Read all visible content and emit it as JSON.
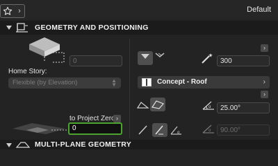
{
  "toolbar": {
    "favorites_icon": "star-outline-icon",
    "more_glyph": "›",
    "preset_label": "Default"
  },
  "section_geometry": {
    "title": "GEOMETRY AND POSITIONING",
    "icon": "geometry-section-icon"
  },
  "geometry": {
    "top_offset_value": "0",
    "home_story_label": "Home Story:",
    "home_story_value": "Flexible (by Elevation)",
    "reference_label": "to Project Zero",
    "bottom_offset_value": "0",
    "thickness_value": "300",
    "surface_override_label": "Concept - Roof",
    "pitch_value": "25.00°",
    "edge_angle_value": "90.00°"
  },
  "section_multiplane": {
    "title": "MULTI-PLANE GEOMETRY",
    "icon": "multi-plane-section-icon"
  },
  "colors": {
    "accent_green": "#4ba52e",
    "panel_bg": "#232323",
    "header_bg": "#1b1b1b"
  }
}
